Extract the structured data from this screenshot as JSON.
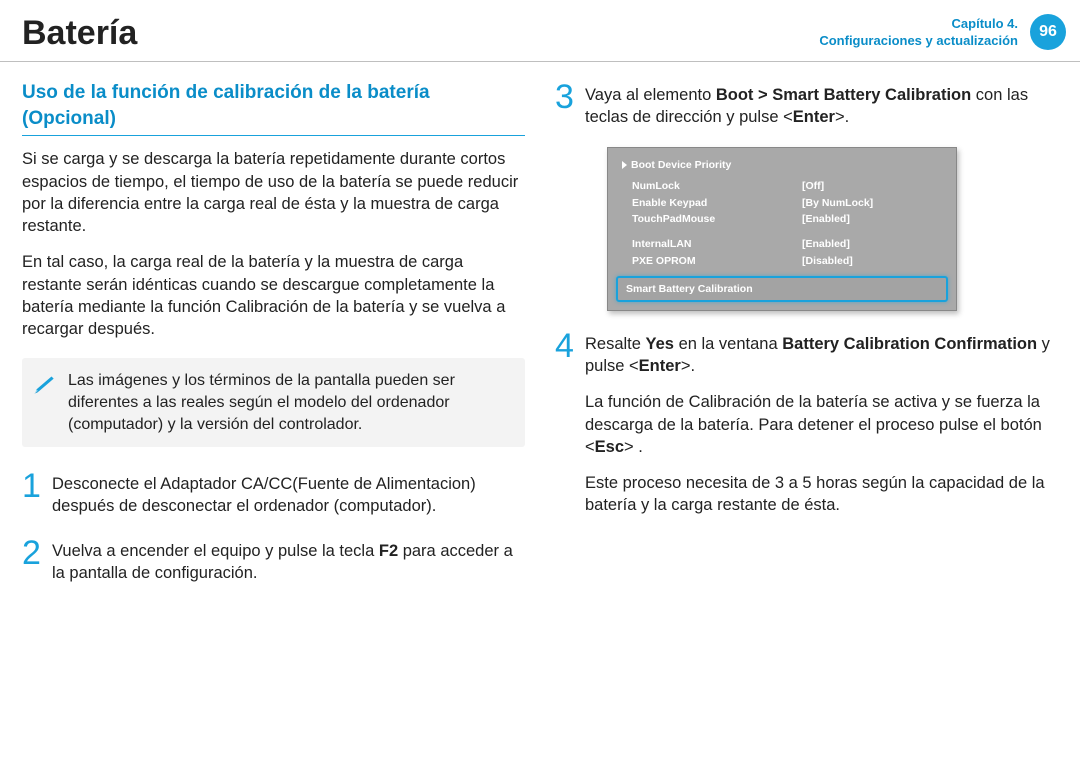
{
  "header": {
    "title": "Batería",
    "chapter_line1": "Capítulo 4.",
    "chapter_line2": "Configuraciones y actualización",
    "page_number": "96"
  },
  "left": {
    "section_heading": "Uso de la función de calibración de la batería (Opcional)",
    "para1": "Si se carga y se descarga la batería repetidamente durante cortos espacios de tiempo, el tiempo de uso de la batería se puede reducir por la diferencia entre la carga real de ésta y la muestra de carga restante.",
    "para2": "En tal caso, la carga real de la batería y la muestra de carga restante serán idénticas cuando se descargue completamente la batería mediante la función Calibración de la batería y se vuelva a recargar después.",
    "note": "Las imágenes y los términos de la pantalla pueden ser diferentes a las reales según el modelo del ordenador (computador) y la versión del controlador.",
    "steps": {
      "s1_num": "1",
      "s1_text": "Desconecte el Adaptador CA/CC(Fuente de Alimentacion) después de desconectar el ordenador (computador).",
      "s2_num": "2",
      "s2_text_a": "Vuelva a encender el equipo y pulse la tecla ",
      "s2_bold": "F2",
      "s2_text_b": " para acceder a la pantalla de configuración."
    }
  },
  "right": {
    "steps": {
      "s3_num": "3",
      "s3_text_a": "Vaya al elemento ",
      "s3_bold": "Boot > Smart Battery Calibration",
      "s3_text_b": " con las teclas de dirección y pulse <",
      "s3_bold2": "Enter",
      "s3_text_c": ">.",
      "s4_num": "4",
      "s4_text_a": "Resalte ",
      "s4_bold_yes": "Yes",
      "s4_text_b": " en la ventana ",
      "s4_bold_win": "Battery Calibration Confirmation",
      "s4_text_c": " y pulse <",
      "s4_bold_enter": "Enter",
      "s4_text_d": ">.",
      "s4_para2_a": "La función de Calibración de la batería se activa y se fuerza la descarga de la batería. Para detener el proceso pulse el botón <",
      "s4_para2_bold": "Esc",
      "s4_para2_b": "> .",
      "s4_para3": "Este proceso necesita de 3 a 5 horas según la capacidad de la batería y la carga restante de ésta."
    },
    "bios": {
      "heading": "Boot Device Priority",
      "rows": [
        {
          "k": "NumLock",
          "v": "[Off]"
        },
        {
          "k": "Enable Keypad",
          "v": "[By NumLock]"
        },
        {
          "k": "TouchPadMouse",
          "v": "[Enabled]"
        }
      ],
      "rows2": [
        {
          "k": "InternalLAN",
          "v": "[Enabled]"
        },
        {
          "k": "PXE OPROM",
          "v": "[Disabled]"
        }
      ],
      "highlight": "Smart Battery Calibration"
    }
  }
}
